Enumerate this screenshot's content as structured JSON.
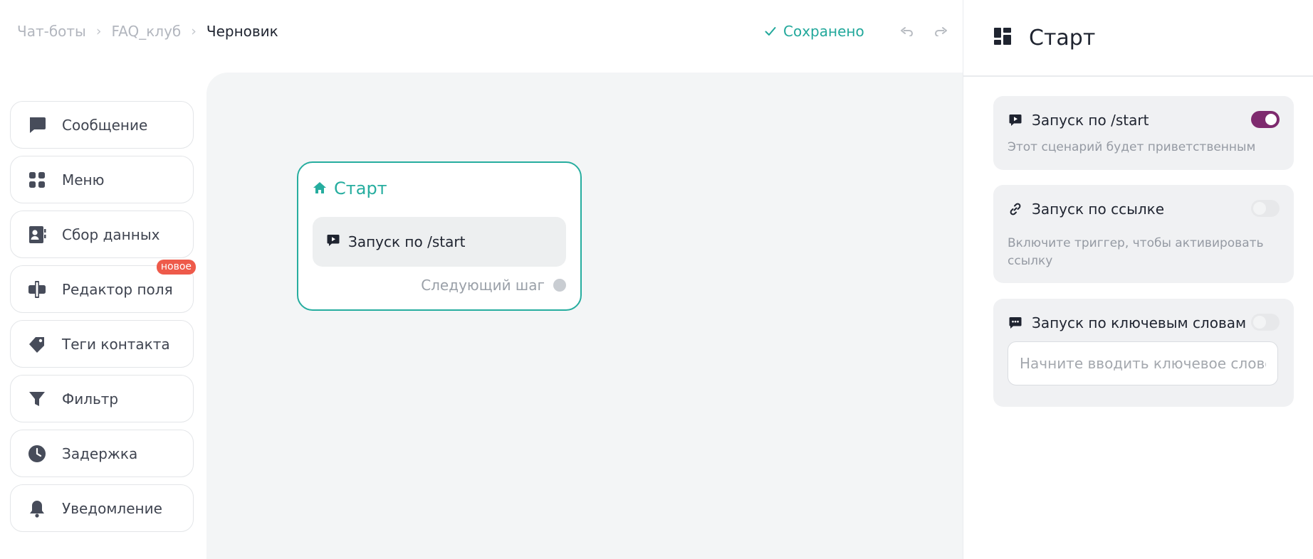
{
  "breadcrumbs": [
    "Чат-боты",
    "FAQ_клуб",
    "Черновик"
  ],
  "breadcrumb_separator": "›",
  "status": {
    "saved_label": "Сохранено",
    "color": "#22a89b"
  },
  "palette": [
    {
      "label": "Сообщение",
      "icon": "message-icon"
    },
    {
      "label": "Меню",
      "icon": "grid-icon"
    },
    {
      "label": "Сбор данных",
      "icon": "contact-card-icon"
    },
    {
      "label": "Редактор поля",
      "icon": "field-editor-icon",
      "badge": "новое"
    },
    {
      "label": "Теги контакта",
      "icon": "tag-icon"
    },
    {
      "label": "Фильтр",
      "icon": "filter-icon"
    },
    {
      "label": "Задержка",
      "icon": "clock-icon"
    },
    {
      "label": "Уведомление",
      "icon": "bell-icon"
    }
  ],
  "node": {
    "title": "Старт",
    "trigger_label": "Запуск по /start",
    "next_step_label": "Следующий шаг",
    "accent": "#26ad9f"
  },
  "panel": {
    "title": "Старт",
    "triggers": [
      {
        "label": "Запуск по /start",
        "enabled": true,
        "description": "Этот сценарий будет приветственным",
        "icon": "play-badge-icon"
      },
      {
        "label": "Запуск по ссылке",
        "enabled": false,
        "description": "Включите триггер, чтобы активировать ссылку",
        "icon": "link-icon"
      },
      {
        "label": "Запуск по ключевым словам",
        "enabled": false,
        "icon": "chat-dots-icon",
        "input_placeholder": "Начните вводить ключевое слово..",
        "input_value": ""
      }
    ],
    "toggle_on_color": "#7e2a6e"
  }
}
